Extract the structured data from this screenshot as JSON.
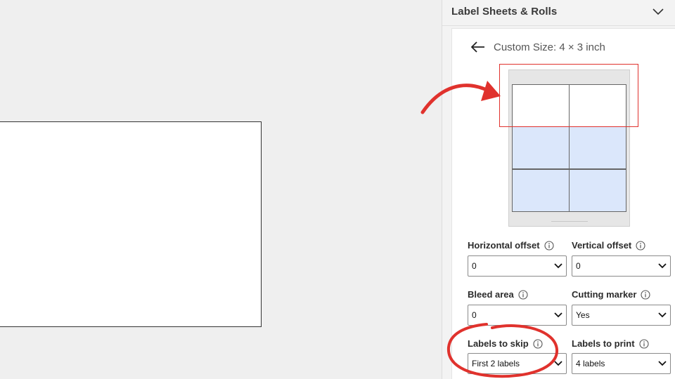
{
  "panel": {
    "title": "Label Sheets & Rolls",
    "subtitle": "Custom Size: 4 × 3 inch"
  },
  "preview": {
    "grid_rows": 3,
    "grid_cols": 2,
    "skipped_labels": 2,
    "skip_color": "#ffffff",
    "print_color": "#dbe7fb"
  },
  "fields": {
    "horizontal_offset": {
      "label": "Horizontal offset",
      "value": "0"
    },
    "vertical_offset": {
      "label": "Vertical offset",
      "value": "0"
    },
    "bleed_area": {
      "label": "Bleed area",
      "value": "0"
    },
    "cutting_marker": {
      "label": "Cutting marker",
      "value": "Yes"
    },
    "labels_to_skip": {
      "label": "Labels to skip",
      "value": "First 2 labels"
    },
    "labels_to_print": {
      "label": "Labels to print",
      "value": "4 labels"
    }
  },
  "icons": {
    "collapse": "chevron-down-icon",
    "back": "arrow-left-icon",
    "info": "info-icon",
    "dropdown": "chevron-down-icon"
  },
  "colors": {
    "annotation_red": "#e0322d",
    "panel_bg": "#f3f3f3",
    "workspace_bg": "#efefef"
  }
}
